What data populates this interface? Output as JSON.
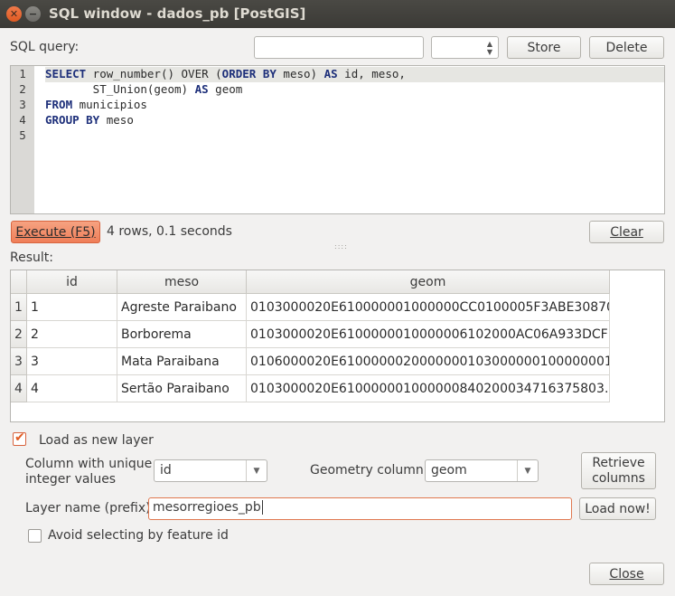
{
  "window": {
    "title": "SQL window - dados_pb [PostGIS]"
  },
  "query_bar": {
    "label": "SQL query:",
    "name_value": "",
    "saved_selected": "",
    "store_label": "Store",
    "delete_label": "Delete"
  },
  "editor": {
    "line_numbers": [
      "1",
      "2",
      "3",
      "4",
      "5"
    ],
    "lines": [
      [
        {
          "t": "SELECT",
          "k": true
        },
        {
          "t": " row_number() OVER (",
          "k": false
        },
        {
          "t": "ORDER BY",
          "k": true
        },
        {
          "t": " meso) ",
          "k": false
        },
        {
          "t": "AS",
          "k": true
        },
        {
          "t": " id, meso,",
          "k": false
        }
      ],
      [
        {
          "t": "       ST_Union(geom) ",
          "k": false
        },
        {
          "t": "AS",
          "k": true
        },
        {
          "t": " geom",
          "k": false
        }
      ],
      [
        {
          "t": "FROM",
          "k": true
        },
        {
          "t": " municipios",
          "k": false
        }
      ],
      [
        {
          "t": "GROUP BY",
          "k": true
        },
        {
          "t": " meso",
          "k": false
        }
      ],
      []
    ]
  },
  "execute": {
    "button_label": "Execute (F5)",
    "status": "4 rows, 0.1 seconds",
    "clear_label": "Clear"
  },
  "result": {
    "label": "Result:",
    "columns": [
      "id",
      "meso",
      "geom"
    ],
    "rows": [
      {
        "num": "1",
        "id": "1",
        "meso": "Agreste Paraibano",
        "geom": "0103000020E610000001000000CC0100005F3ABE30870…"
      },
      {
        "num": "2",
        "id": "2",
        "meso": "Borborema",
        "geom": "0103000020E6100000010000006102000AC06A933DCF…"
      },
      {
        "num": "3",
        "id": "3",
        "meso": "Mata Paraibana",
        "geom": "0106000020E6100000020000000103000000100000001…"
      },
      {
        "num": "4",
        "id": "4",
        "meso": "Sertão Paraibano",
        "geom": "0103000020E610000001000000840200034716375803…"
      }
    ]
  },
  "load": {
    "load_as_layer_label": "Load as new layer",
    "load_as_layer_checked": true,
    "unique_col_label": "Column with unique\ninteger values",
    "unique_col_value": "id",
    "geom_col_label": "Geometry column",
    "geom_col_value": "geom",
    "retrieve_label": "Retrieve\ncolumns",
    "layer_name_label": "Layer name (prefix)",
    "layer_name_value": "mesorregioes_pb",
    "load_now_label": "Load now!",
    "avoid_label": "Avoid selecting by feature id",
    "avoid_checked": false
  },
  "footer": {
    "close_label": "Close"
  },
  "colors": {
    "accent": "#e05a22",
    "keyword": "#1d2f7a",
    "titlebar": "#3b3a36"
  }
}
